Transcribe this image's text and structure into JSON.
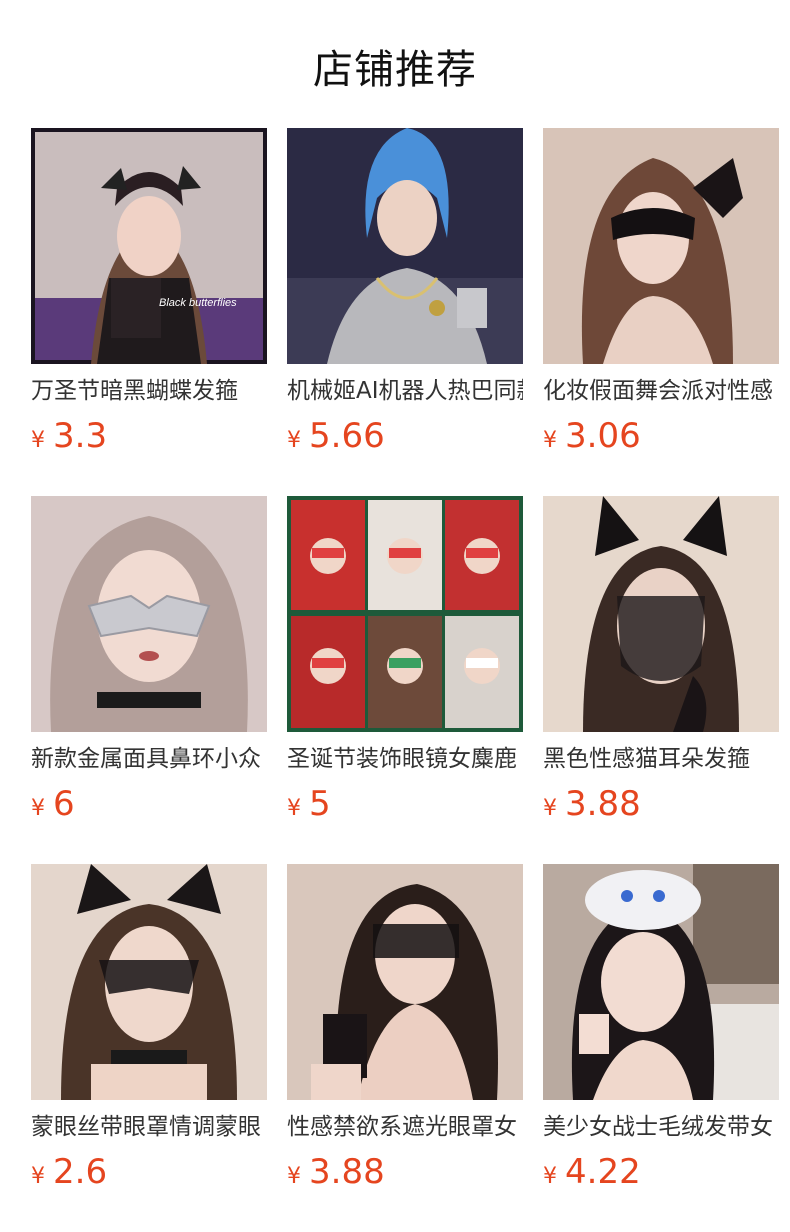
{
  "page_title": "店铺推荐",
  "colors": {
    "price": "#e5451f",
    "title_text": "#333333"
  },
  "products": [
    {
      "title": "万圣节暗黑蝴蝶发箍",
      "currency": "¥",
      "price": "3.3",
      "overlay_text": "Black butterflies"
    },
    {
      "title": "机械姬AI机器人热巴同款",
      "currency": "¥",
      "price": "5.66"
    },
    {
      "title": "化妆假面舞会派对性感",
      "currency": "¥",
      "price": "3.06"
    },
    {
      "title": "新款金属面具鼻环小众",
      "currency": "¥",
      "price": "6"
    },
    {
      "title": "圣诞节装饰眼镜女麋鹿",
      "currency": "¥",
      "price": "5"
    },
    {
      "title": "黑色性感猫耳朵发箍",
      "currency": "¥",
      "price": "3.88"
    },
    {
      "title": "蒙眼丝带眼罩情调蒙眼",
      "currency": "¥",
      "price": "2.6"
    },
    {
      "title": "性感禁欲系遮光眼罩女",
      "currency": "¥",
      "price": "3.88"
    },
    {
      "title": "美少女战士毛绒发带女",
      "currency": "¥",
      "price": "4.22"
    }
  ]
}
